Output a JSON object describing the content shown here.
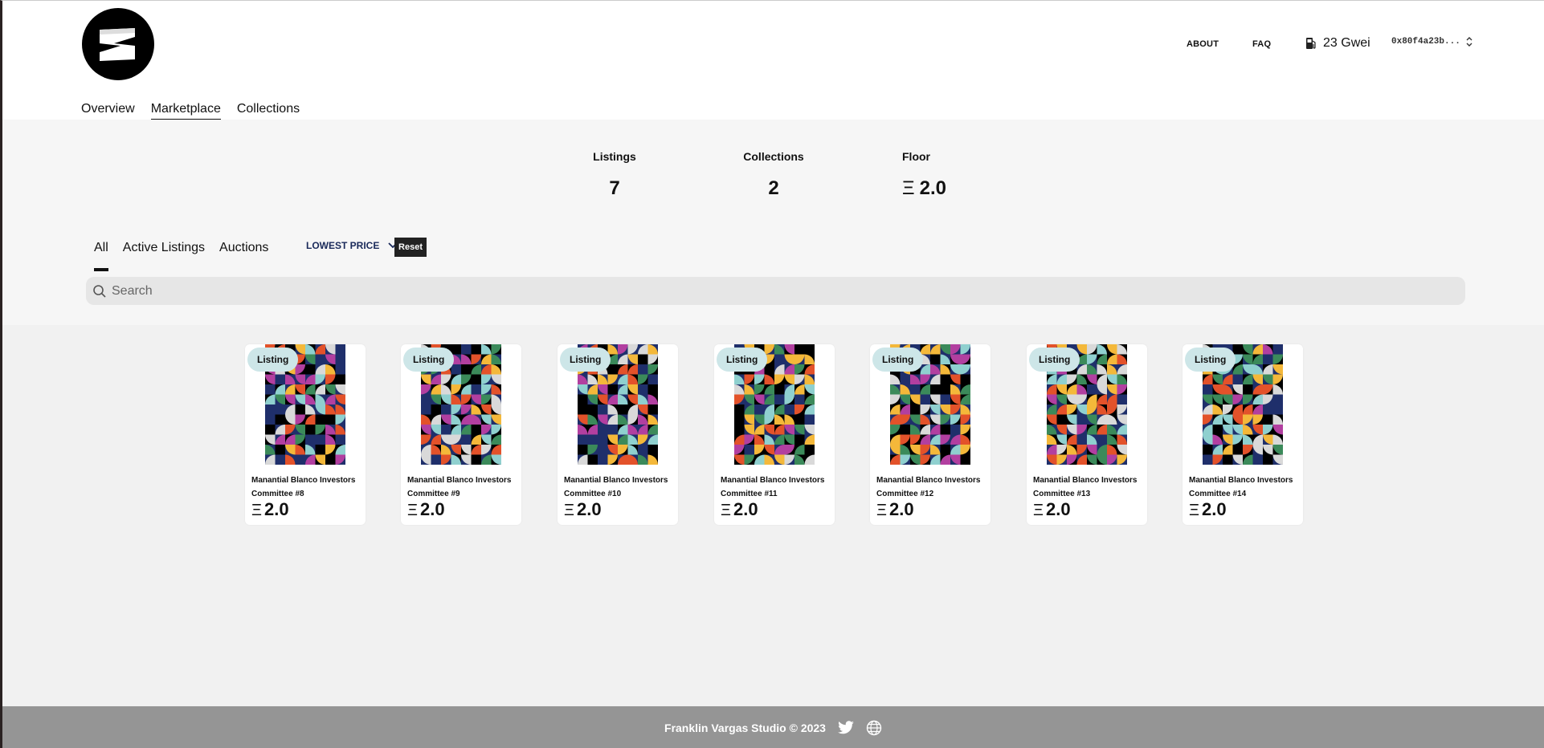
{
  "header": {
    "nav": {
      "about": "ABOUT",
      "faq": "FAQ"
    },
    "gas": "23 Gwei",
    "wallet": "0x80f4a23b..."
  },
  "tabs": [
    "Overview",
    "Marketplace",
    "Collections"
  ],
  "active_tab": "Marketplace",
  "stats": [
    {
      "label": "Listings",
      "value": "7"
    },
    {
      "label": "Collections",
      "value": "2"
    },
    {
      "label": "Floor",
      "value": "2.0",
      "prefix": "Ξ"
    }
  ],
  "filters": {
    "sub_tabs": [
      "All",
      "Active Listings",
      "Auctions"
    ],
    "active_sub_tab": "All",
    "sort_label": "LOWEST PRICE",
    "reset_label": "Reset",
    "search_placeholder": "Search"
  },
  "cards": [
    {
      "badge": "Listing",
      "title": "Manantial Blanco Investors Committee #8",
      "price": "2.0",
      "currency": "Ξ"
    },
    {
      "badge": "Listing",
      "title": "Manantial Blanco Investors Committee #9",
      "price": "2.0",
      "currency": "Ξ"
    },
    {
      "badge": "Listing",
      "title": "Manantial Blanco Investors Committee #10",
      "price": "2.0",
      "currency": "Ξ"
    },
    {
      "badge": "Listing",
      "title": "Manantial Blanco Investors Committee #11",
      "price": "2.0",
      "currency": "Ξ"
    },
    {
      "badge": "Listing",
      "title": "Manantial Blanco Investors Committee #12",
      "price": "2.0",
      "currency": "Ξ"
    },
    {
      "badge": "Listing",
      "title": "Manantial Blanco Investors Committee #13",
      "price": "2.0",
      "currency": "Ξ"
    },
    {
      "badge": "Listing",
      "title": "Manantial Blanco Investors Committee #14",
      "price": "2.0",
      "currency": "Ξ"
    }
  ],
  "footer": {
    "text": "Franklin Vargas Studio © 2023"
  },
  "palette": [
    "#1f2f6b",
    "#000000",
    "#e3522a",
    "#f4b83a",
    "#8fd0cf",
    "#3b8a5a",
    "#b23fa0",
    "#d9d9d9"
  ]
}
